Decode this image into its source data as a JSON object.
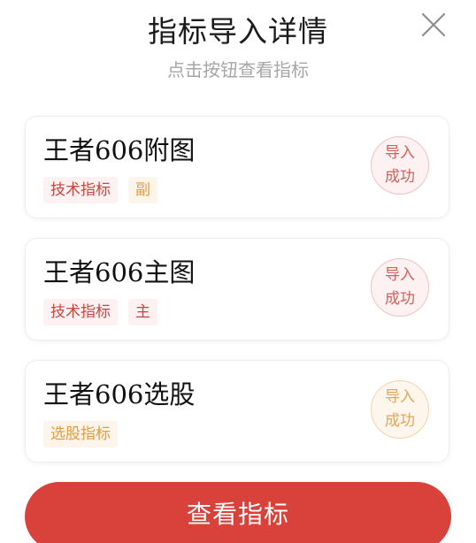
{
  "header": {
    "title": "指标导入详情",
    "subtitle": "点击按钮查看指标",
    "close_icon": "close-icon"
  },
  "cards": [
    {
      "name": "王者606附图",
      "tags": [
        "技术指标",
        "副"
      ],
      "tag_color": "#c9463f",
      "status_line1": "导入",
      "status_line2": "成功",
      "status_color": "#d3605a"
    },
    {
      "name": "王者606主图",
      "tags": [
        "技术指标",
        "主"
      ],
      "tag_color": "#c9463f",
      "status_line1": "导入",
      "status_line2": "成功",
      "status_color": "#d3605a"
    },
    {
      "name": "王者606选股",
      "tags": [
        "选股指标"
      ],
      "tag_color": "#e39b40",
      "status_line1": "导入",
      "status_line2": "成功",
      "status_color": "#e6a45a"
    }
  ],
  "cta": {
    "label": "查看指标",
    "color": "#d9413b"
  }
}
